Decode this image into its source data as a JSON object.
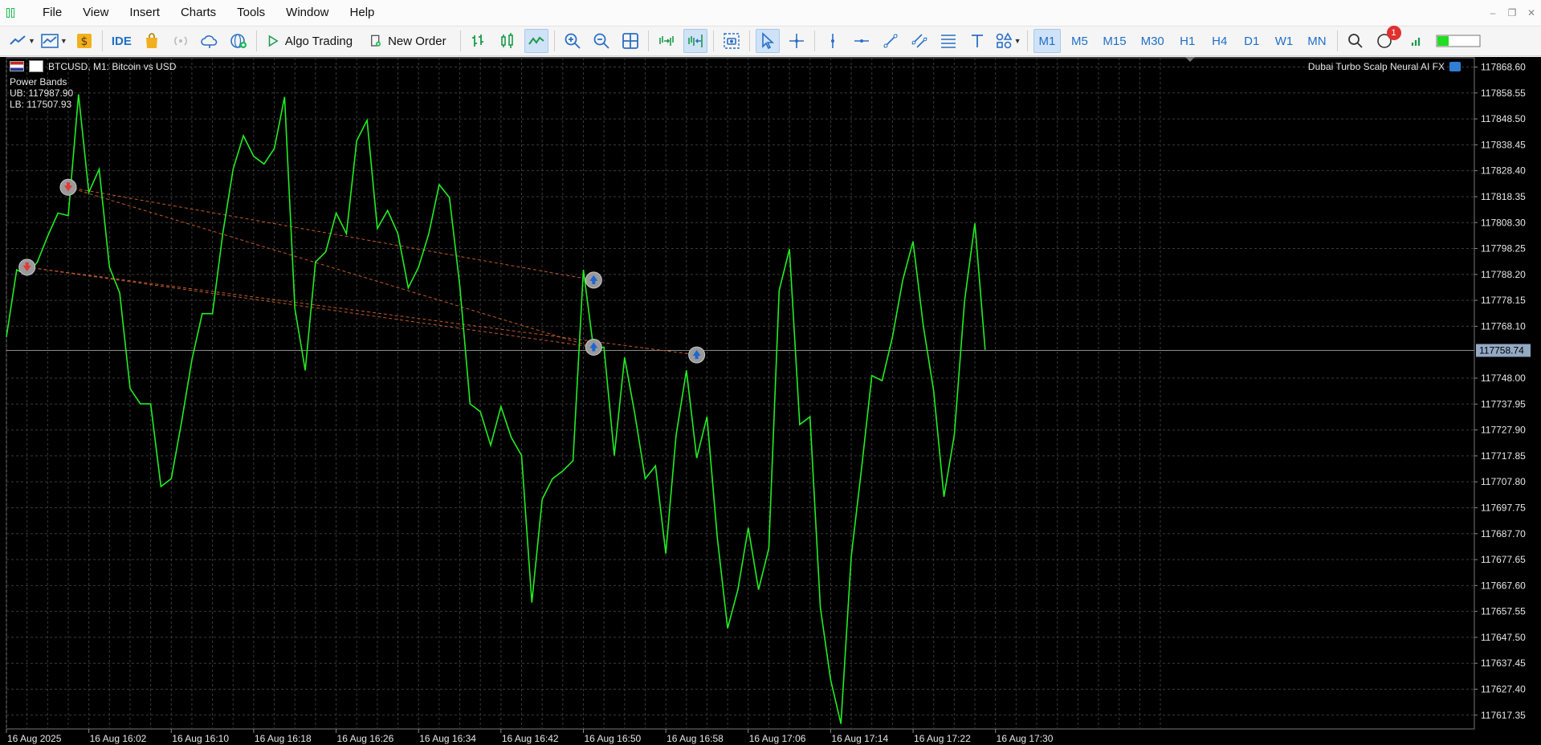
{
  "menu": {
    "items": [
      "File",
      "View",
      "Insert",
      "Charts",
      "Tools",
      "Window",
      "Help"
    ]
  },
  "toolbar": {
    "ide_label": "IDE",
    "algo_trading_label": "Algo Trading",
    "new_order_label": "New Order",
    "timeframes": [
      "M1",
      "M5",
      "M15",
      "M30",
      "H1",
      "H4",
      "D1",
      "W1",
      "MN"
    ],
    "active_timeframe": "M1",
    "notification_count": "1"
  },
  "chart": {
    "symbol_info": "BTCUSD, M1:  Bitcoin vs USD",
    "expert_name": "Dubai Turbo Scalp Neural AI FX",
    "indicator_name": "Power Bands",
    "upper_band": "UB: 117987.90",
    "lower_band": "LB: 117507.93",
    "current_price_label": "117758.74",
    "colors": {
      "background": "#000000",
      "line": "#22ee22",
      "grid": "#3a3a3a",
      "text": "#e6e6e6",
      "price_tag": "#93a9c4",
      "trade_line": "#c05a2a"
    }
  },
  "chart_data": {
    "type": "line",
    "symbol": "BTCUSD",
    "timeframe": "M1",
    "ylim": [
      117612.0,
      117870.0
    ],
    "y_ticks": [
      "117868.60",
      "117858.55",
      "117848.50",
      "117838.45",
      "117828.40",
      "117818.35",
      "117808.30",
      "117798.25",
      "117788.20",
      "117778.15",
      "117768.10",
      "117748.00",
      "117737.95",
      "117727.90",
      "117717.85",
      "117707.80",
      "117697.75",
      "117687.70",
      "117677.65",
      "117667.60",
      "117657.55",
      "117647.50",
      "117637.45",
      "117627.40",
      "117617.35"
    ],
    "x_labels": [
      "16 Aug 2025",
      "16 Aug 16:02",
      "16 Aug 16:10",
      "16 Aug 16:18",
      "16 Aug 16:26",
      "16 Aug 16:34",
      "16 Aug 16:42",
      "16 Aug 16:50",
      "16 Aug 16:58",
      "16 Aug 17:06",
      "16 Aug 17:14",
      "16 Aug 17:22",
      "16 Aug 17:30"
    ],
    "current_price": 117758.74,
    "series": [
      {
        "values": [
          117764,
          117790,
          117788,
          117793,
          117803,
          117812,
          117811,
          117858,
          117820,
          117829,
          117791,
          117781,
          117744,
          117738,
          117738,
          117706,
          117709,
          117731,
          117755,
          117773,
          117773,
          117804,
          117829,
          117842,
          117834,
          117831,
          117837,
          117857,
          117775,
          117751,
          117793,
          117797,
          117812,
          117804,
          117840,
          117848,
          117806,
          117813,
          117804,
          117783,
          117791,
          117804,
          117823,
          117818,
          117784,
          117738,
          117735,
          117722,
          117737,
          117725,
          117718,
          117661,
          117701,
          117709,
          117712,
          117716,
          117790,
          117759,
          117760,
          117718,
          117756,
          117734,
          117709,
          117714,
          117680,
          117726,
          117751,
          117717,
          117733,
          117686,
          117651,
          117666,
          117690,
          117666,
          117682,
          117782,
          117798,
          117730,
          117733,
          117659,
          117631,
          117614,
          117679,
          117713,
          117749,
          117747,
          117764,
          117786,
          117801,
          117768,
          117743,
          117702,
          117726,
          117778,
          117808,
          117759
        ]
      }
    ],
    "trade_markers": [
      {
        "direction": "sell",
        "index": 2,
        "price": 117791
      },
      {
        "direction": "sell",
        "index": 6,
        "price": 117822
      },
      {
        "direction": "buy",
        "index": 57,
        "price": 117786
      },
      {
        "direction": "buy",
        "index": 57,
        "price": 117760
      },
      {
        "direction": "buy",
        "index": 67,
        "price": 117757
      }
    ]
  }
}
